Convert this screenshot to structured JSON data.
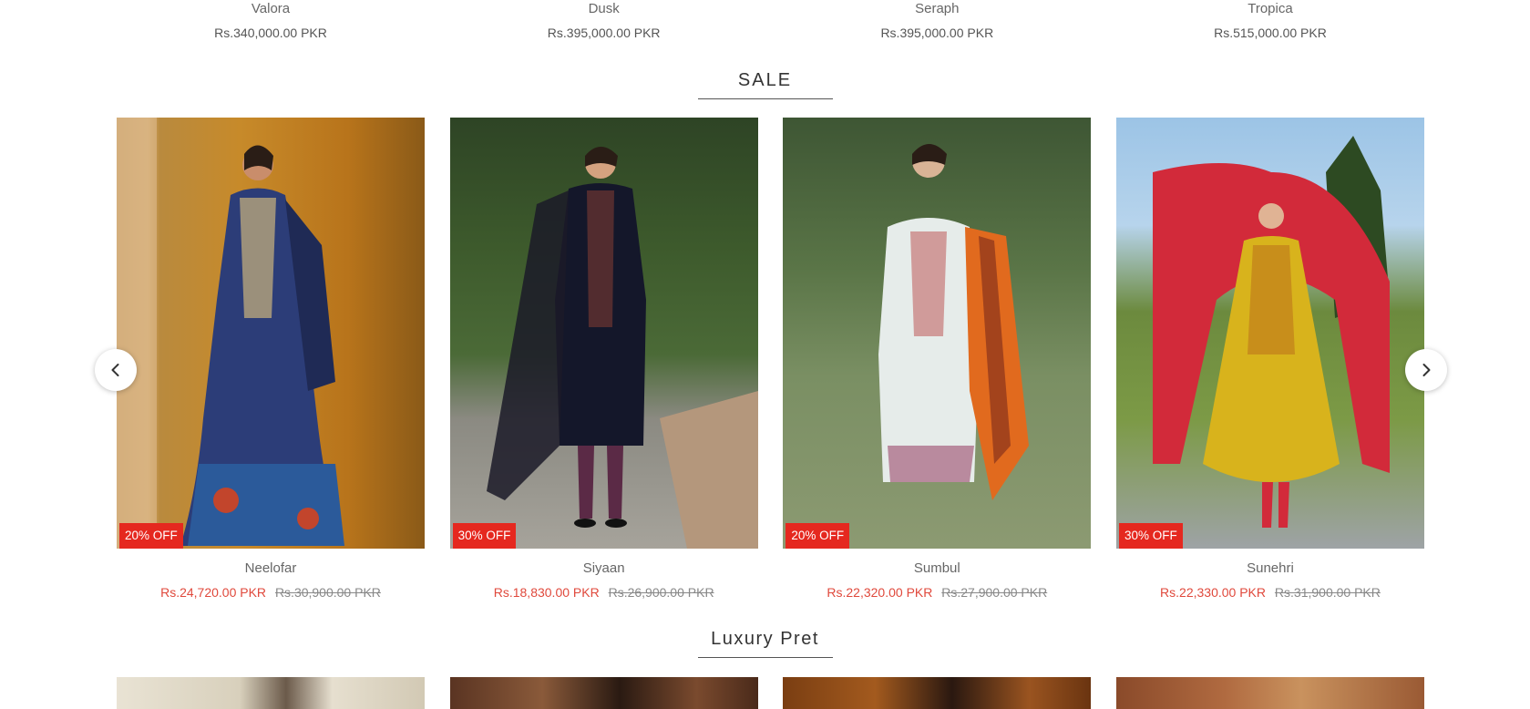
{
  "previous_row": {
    "items": [
      {
        "name": "Valora",
        "price": "Rs.340,000.00 PKR"
      },
      {
        "name": "Dusk",
        "price": "Rs.395,000.00 PKR"
      },
      {
        "name": "Seraph",
        "price": "Rs.395,000.00 PKR"
      },
      {
        "name": "Tropica",
        "price": "Rs.515,000.00 PKR"
      }
    ]
  },
  "sale": {
    "title": "SALE",
    "products": [
      {
        "name": "Neelofar",
        "badge": "20% OFF",
        "sale_price": "Rs.24,720.00 PKR",
        "original_price": "Rs.30,900.00 PKR"
      },
      {
        "name": "Siyaan",
        "badge": "30% OFF",
        "sale_price": "Rs.18,830.00 PKR",
        "original_price": "Rs.26,900.00 PKR"
      },
      {
        "name": "Sumbul",
        "badge": "20% OFF",
        "sale_price": "Rs.22,320.00 PKR",
        "original_price": "Rs.27,900.00 PKR"
      },
      {
        "name": "Sunehri",
        "badge": "30% OFF",
        "sale_price": "Rs.22,330.00 PKR",
        "original_price": "Rs.31,900.00 PKR"
      }
    ]
  },
  "luxury_pret": {
    "title": "Luxury Pret"
  },
  "icons": {
    "prev": "chevron-left-icon",
    "next": "chevron-right-icon"
  },
  "colors": {
    "badge_bg": "#e5281f",
    "sale_price": "#e0493c",
    "original_price": "#888888"
  }
}
